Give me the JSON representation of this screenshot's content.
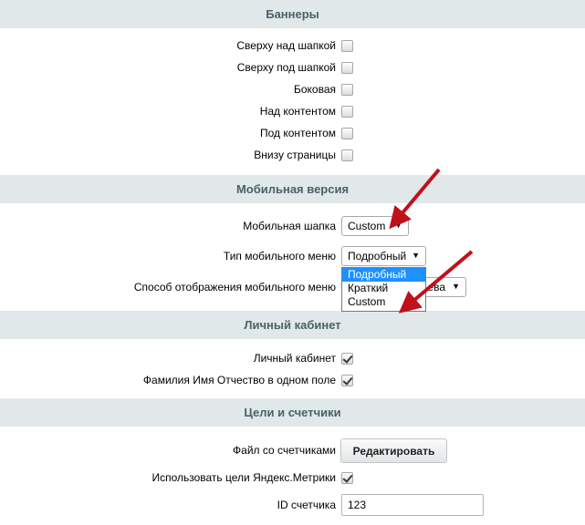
{
  "sections": {
    "banners": {
      "title": "Баннеры",
      "items": [
        {
          "label": "Сверху над шапкой",
          "checked": false
        },
        {
          "label": "Сверху под шапкой",
          "checked": false
        },
        {
          "label": "Боковая",
          "checked": false
        },
        {
          "label": "Над контентом",
          "checked": false
        },
        {
          "label": "Под контентом",
          "checked": false
        },
        {
          "label": "Внизу страницы",
          "checked": false
        }
      ]
    },
    "mobile": {
      "title": "Мобильная версия",
      "header_label": "Мобильная шапка",
      "header_value": "Custom",
      "menu_type_label": "Тип мобильного меню",
      "menu_type_value": "Подробный",
      "menu_type_options": [
        "Подробный",
        "Краткий",
        "Custom"
      ],
      "display_mode_label": "Способ отображения мобильного меню",
      "display_mode_value_visible": "ева"
    },
    "cabinet": {
      "title": "Личный кабинет",
      "items": [
        {
          "label": "Личный кабинет",
          "checked": true
        },
        {
          "label": "Фамилия Имя Отчество в одном поле",
          "checked": true
        }
      ]
    },
    "goals": {
      "title": "Цели и счетчики",
      "counters_file_label": "Файл со счетчиками",
      "edit_button_label": "Редактировать",
      "yandex_goals_label": "Использовать цели Яндекс.Метрики",
      "yandex_goals_checked": true,
      "counter_id_label": "ID счетчика",
      "counter_id_value": "123"
    }
  },
  "colors": {
    "section_header_bg": "#e0e8ea",
    "section_header_text": "#4b6267",
    "annotation_arrow": "#c0101a",
    "selected_option_bg": "#1e90ff"
  }
}
